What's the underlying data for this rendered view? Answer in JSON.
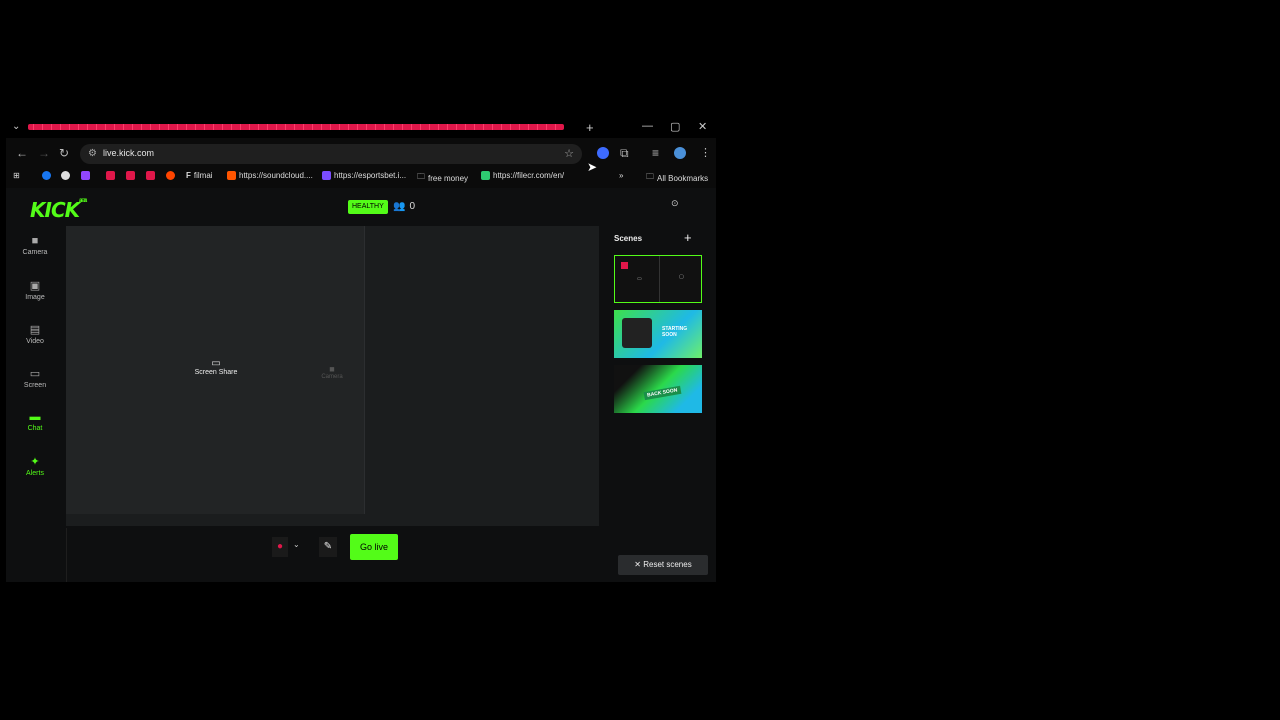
{
  "browser": {
    "url": "live.kick.com",
    "bookmarks": [
      {
        "label": "filmai",
        "color": "#ffffff"
      },
      {
        "label": "https://soundcloud....",
        "color": "#ff5500"
      },
      {
        "label": "https://esportsbet.i...",
        "color": "#7b4dff"
      },
      {
        "label": "free money",
        "color": "#bbbbbb"
      },
      {
        "label": "https://filecr.com/en/",
        "color": "#2ecc71"
      }
    ],
    "bookmark_initial": "F",
    "all_bookmarks": "All Bookmarks"
  },
  "app": {
    "health": "HEALTHY",
    "viewers": "0",
    "sidebar": [
      {
        "label": "Camera",
        "icon": "camera-icon"
      },
      {
        "label": "Image",
        "icon": "image-icon"
      },
      {
        "label": "Video",
        "icon": "video-icon"
      },
      {
        "label": "Screen",
        "icon": "screen-icon"
      },
      {
        "label": "Chat",
        "icon": "chat-icon"
      },
      {
        "label": "Alerts",
        "icon": "alerts-icon"
      }
    ],
    "canvas": {
      "screen_share": "Screen Share",
      "camera": "Camera"
    },
    "go_live": "Go live",
    "scenes_title": "Scenes",
    "scene_thumb_texts": [
      "STARTING SOON",
      "BACK SOON"
    ],
    "reset_scenes": "Reset scenes"
  },
  "colors": {
    "accent": "#53fc18",
    "tab_red": "#e0174a"
  }
}
